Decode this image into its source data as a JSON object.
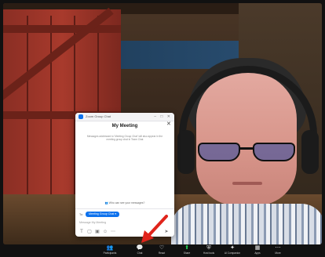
{
  "chat": {
    "window_title": "Zoom Group Chat",
    "header": "My Meeting",
    "info": "Messages addressed to 'Meeting Group Chat' will also appear in the meeting group chat in Team Chat",
    "notice": "Who can see your messages?",
    "to_label": "To:",
    "recipient": "Meeting Group Chat",
    "message_placeholder": "Message My Meeting",
    "close_glyph": "✕",
    "window_buttons": "– □ ✕"
  },
  "toolbar": {
    "items": [
      {
        "label": "Participants",
        "icon": "participants-icon",
        "glyph": "👥"
      },
      {
        "label": "Chat",
        "icon": "chat-icon",
        "glyph": "💬"
      },
      {
        "label": "React",
        "icon": "react-icon",
        "glyph": "♡"
      },
      {
        "label": "Share",
        "icon": "share-icon",
        "glyph": "⬆"
      },
      {
        "label": "Host tools",
        "icon": "shield-icon",
        "glyph": "⛨"
      },
      {
        "label": "AI Companion",
        "icon": "ai-companion-icon",
        "glyph": "✦"
      },
      {
        "label": "Apps",
        "icon": "apps-icon",
        "glyph": "▦"
      },
      {
        "label": "More",
        "icon": "more-icon",
        "glyph": "⋯"
      }
    ]
  },
  "colors": {
    "accent": "#0e72ed",
    "share_green": "#23d959",
    "arrow_red": "#e0241b"
  }
}
